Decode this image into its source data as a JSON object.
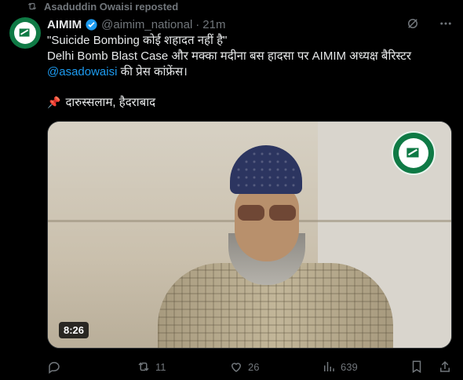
{
  "repost": {
    "label": "Asaduddin Owaisi reposted",
    "icon": "repost-icon"
  },
  "author": {
    "name": "AIMIM",
    "handle": "@aimim_national",
    "dot": "·",
    "time": "21m",
    "verified_color": "#1d9bf0"
  },
  "tweet": {
    "line1": "\"Suicide Bombing कोई शहादत नहीं है\"",
    "line2": "Delhi Bomb Blast Case और मक्का मदीना बस हादसा पर AIMIM अध्यक्ष बैरिस्टर",
    "mention": "@asadowaisi",
    "line3_rest": " की प्रेस कांफ्रेंस।",
    "location": "दारुस्सलाम, हैदराबाद"
  },
  "media": {
    "duration": "8:26"
  },
  "metrics": {
    "replies": "",
    "reposts": "11",
    "likes": "26",
    "views": "639"
  },
  "colors": {
    "accent": "#1d9bf0",
    "muted": "#71767b",
    "brand_green": "#0f7a45"
  }
}
